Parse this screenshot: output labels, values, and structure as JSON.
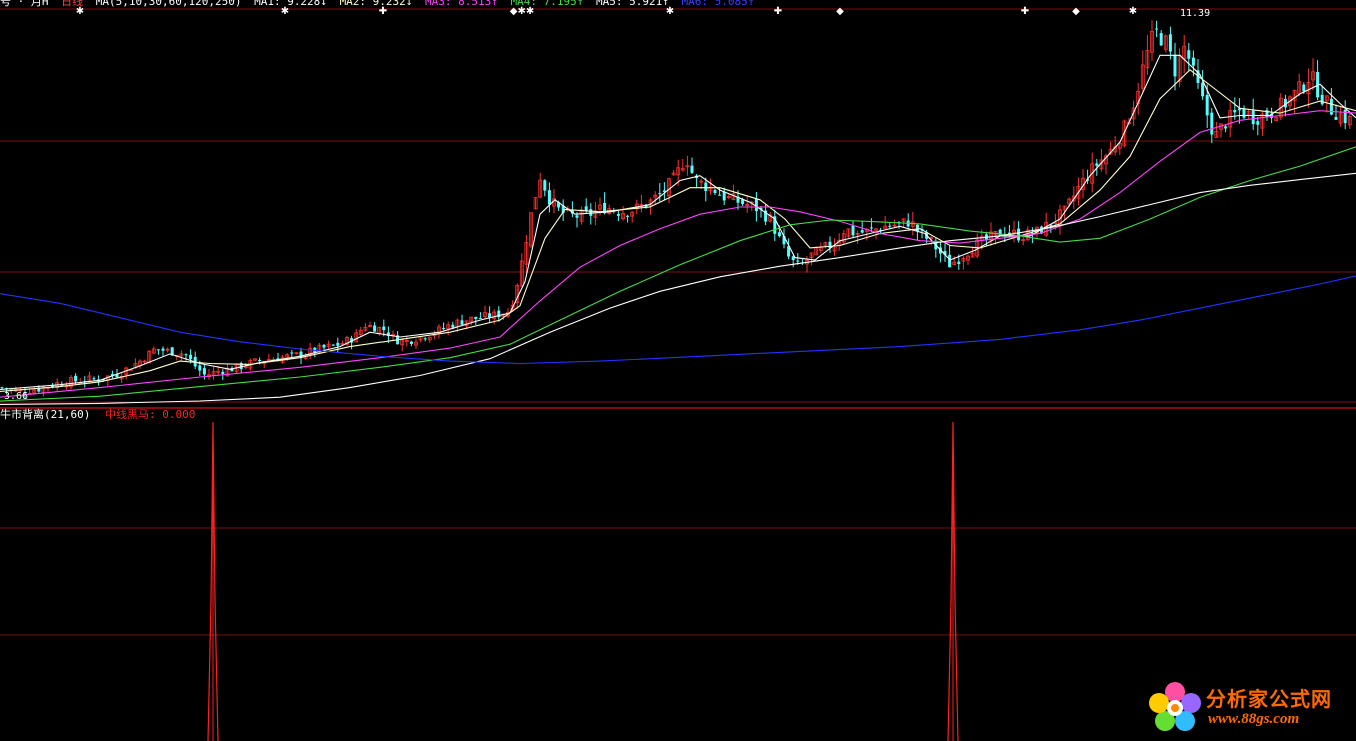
{
  "colors": {
    "bg": "#000000",
    "grid": "#7a1010",
    "up": "#ff3030",
    "down": "#54ffff",
    "ma1": "#ffffff",
    "ma2": "#ffffcc",
    "ma3": "#ff44ff",
    "ma4": "#44dd44",
    "ma5": "#ffffff",
    "ma6": "#2233ff",
    "signal": "#ff2020",
    "header_text": "#ffffff"
  },
  "header": {
    "title": "号 · 月H",
    "period": "日线",
    "ma_params": "MA(5,10,30,60,120,250)",
    "ma1": "MA1: 9.228↓",
    "ma2": "MA2: 9.232↓",
    "ma3": "MA3: 8.513↑",
    "ma4": "MA4: 7.195↑",
    "ma5": "MA5: 5.921↑",
    "ma6": "MA6: 5.085↑"
  },
  "sub_header": {
    "name": "牛市背离(21,60)",
    "indicator": "中线黑马: 0.000"
  },
  "watermark": {
    "text": "分析家公式网",
    "url": "www.88gs.com"
  },
  "chart_data": {
    "type": "candlestick",
    "price_range": [
      3.5,
      11.6
    ],
    "low_label": "3.66",
    "high_label": "11.39",
    "grid": true,
    "close_curve": [
      [
        0,
        3.8
      ],
      [
        20,
        3.72
      ],
      [
        40,
        3.78
      ],
      [
        60,
        3.9
      ],
      [
        80,
        3.95
      ],
      [
        100,
        3.98
      ],
      [
        120,
        4.1
      ],
      [
        140,
        4.35
      ],
      [
        155,
        4.6
      ],
      [
        170,
        4.55
      ],
      [
        185,
        4.5
      ],
      [
        195,
        4.25
      ],
      [
        205,
        4.05
      ],
      [
        220,
        4.15
      ],
      [
        235,
        4.2
      ],
      [
        250,
        4.3
      ],
      [
        265,
        4.38
      ],
      [
        280,
        4.42
      ],
      [
        300,
        4.48
      ],
      [
        320,
        4.6
      ],
      [
        340,
        4.7
      ],
      [
        355,
        4.85
      ],
      [
        365,
        5.1
      ],
      [
        375,
        5.05
      ],
      [
        385,
        5.0
      ],
      [
        395,
        4.8
      ],
      [
        405,
        4.75
      ],
      [
        420,
        4.85
      ],
      [
        435,
        4.95
      ],
      [
        450,
        5.1
      ],
      [
        465,
        5.2
      ],
      [
        480,
        5.25
      ],
      [
        495,
        5.3
      ],
      [
        510,
        5.4
      ],
      [
        520,
        6.2
      ],
      [
        530,
        7.3
      ],
      [
        540,
        8.2
      ],
      [
        550,
        7.7
      ],
      [
        560,
        7.45
      ],
      [
        575,
        7.35
      ],
      [
        590,
        7.4
      ],
      [
        605,
        7.55
      ],
      [
        620,
        7.45
      ],
      [
        635,
        7.5
      ],
      [
        650,
        7.65
      ],
      [
        665,
        7.9
      ],
      [
        675,
        8.15
      ],
      [
        686,
        8.6
      ],
      [
        695,
        8.1
      ],
      [
        705,
        8.0
      ],
      [
        715,
        7.9
      ],
      [
        725,
        7.75
      ],
      [
        740,
        7.65
      ],
      [
        755,
        7.55
      ],
      [
        770,
        7.3
      ],
      [
        780,
        6.85
      ],
      [
        790,
        6.45
      ],
      [
        800,
        6.3
      ],
      [
        812,
        6.55
      ],
      [
        825,
        6.7
      ],
      [
        835,
        6.8
      ],
      [
        845,
        7.1
      ],
      [
        855,
        7.0
      ],
      [
        870,
        7.05
      ],
      [
        885,
        7.15
      ],
      [
        900,
        7.2
      ],
      [
        910,
        7.25
      ],
      [
        920,
        7.0
      ],
      [
        930,
        6.85
      ],
      [
        940,
        6.6
      ],
      [
        950,
        6.35
      ],
      [
        960,
        6.5
      ],
      [
        975,
        6.75
      ],
      [
        990,
        6.9
      ],
      [
        1005,
        7.05
      ],
      [
        1020,
        6.95
      ],
      [
        1035,
        7.0
      ],
      [
        1050,
        7.2
      ],
      [
        1065,
        7.45
      ],
      [
        1080,
        8.0
      ],
      [
        1095,
        8.4
      ],
      [
        1110,
        8.7
      ],
      [
        1125,
        9.2
      ],
      [
        1135,
        9.8
      ],
      [
        1145,
        10.6
      ],
      [
        1155,
        11.2
      ],
      [
        1165,
        11.0
      ],
      [
        1175,
        10.4
      ],
      [
        1185,
        10.9
      ],
      [
        1195,
        10.2
      ],
      [
        1205,
        9.6
      ],
      [
        1215,
        9.0
      ],
      [
        1225,
        9.3
      ],
      [
        1240,
        9.55
      ],
      [
        1255,
        9.4
      ],
      [
        1270,
        9.5
      ],
      [
        1285,
        9.7
      ],
      [
        1300,
        10.0
      ],
      [
        1310,
        10.3
      ],
      [
        1320,
        9.9
      ],
      [
        1330,
        9.6
      ],
      [
        1345,
        9.4
      ],
      [
        1356,
        9.3
      ]
    ],
    "series": [
      {
        "name": "MA1",
        "color": "#ffffff",
        "points": [
          [
            0,
            3.76
          ],
          [
            60,
            3.86
          ],
          [
            100,
            3.95
          ],
          [
            140,
            4.25
          ],
          [
            170,
            4.5
          ],
          [
            200,
            4.3
          ],
          [
            230,
            4.18
          ],
          [
            260,
            4.32
          ],
          [
            300,
            4.45
          ],
          [
            340,
            4.65
          ],
          [
            370,
            4.95
          ],
          [
            400,
            4.85
          ],
          [
            440,
            4.95
          ],
          [
            480,
            5.2
          ],
          [
            510,
            5.35
          ],
          [
            525,
            6.0
          ],
          [
            540,
            7.4
          ],
          [
            555,
            7.7
          ],
          [
            575,
            7.4
          ],
          [
            610,
            7.45
          ],
          [
            650,
            7.6
          ],
          [
            680,
            8.1
          ],
          [
            700,
            8.2
          ],
          [
            720,
            7.9
          ],
          [
            750,
            7.65
          ],
          [
            775,
            7.3
          ],
          [
            795,
            6.5
          ],
          [
            815,
            6.45
          ],
          [
            840,
            6.85
          ],
          [
            870,
            7.0
          ],
          [
            900,
            7.15
          ],
          [
            925,
            7.0
          ],
          [
            950,
            6.45
          ],
          [
            975,
            6.65
          ],
          [
            1000,
            6.95
          ],
          [
            1030,
            6.95
          ],
          [
            1060,
            7.3
          ],
          [
            1090,
            8.2
          ],
          [
            1120,
            8.9
          ],
          [
            1140,
            9.8
          ],
          [
            1160,
            10.7
          ],
          [
            1180,
            10.7
          ],
          [
            1200,
            10.3
          ],
          [
            1220,
            9.4
          ],
          [
            1240,
            9.45
          ],
          [
            1270,
            9.45
          ],
          [
            1300,
            9.9
          ],
          [
            1320,
            10.1
          ],
          [
            1340,
            9.7
          ],
          [
            1356,
            9.4
          ]
        ]
      },
      {
        "name": "MA2",
        "color": "#ffffcc",
        "points": [
          [
            0,
            3.72
          ],
          [
            60,
            3.82
          ],
          [
            100,
            3.92
          ],
          [
            150,
            4.15
          ],
          [
            180,
            4.35
          ],
          [
            210,
            4.3
          ],
          [
            250,
            4.28
          ],
          [
            300,
            4.42
          ],
          [
            350,
            4.65
          ],
          [
            400,
            4.8
          ],
          [
            450,
            4.95
          ],
          [
            500,
            5.2
          ],
          [
            520,
            5.5
          ],
          [
            545,
            6.9
          ],
          [
            565,
            7.5
          ],
          [
            600,
            7.45
          ],
          [
            650,
            7.55
          ],
          [
            690,
            7.95
          ],
          [
            720,
            7.95
          ],
          [
            760,
            7.7
          ],
          [
            785,
            7.3
          ],
          [
            810,
            6.7
          ],
          [
            840,
            6.75
          ],
          [
            880,
            7.0
          ],
          [
            920,
            7.1
          ],
          [
            950,
            6.75
          ],
          [
            980,
            6.7
          ],
          [
            1020,
            6.95
          ],
          [
            1060,
            7.2
          ],
          [
            1100,
            7.9
          ],
          [
            1130,
            8.6
          ],
          [
            1160,
            9.8
          ],
          [
            1190,
            10.4
          ],
          [
            1215,
            10.0
          ],
          [
            1240,
            9.6
          ],
          [
            1280,
            9.5
          ],
          [
            1320,
            9.75
          ],
          [
            1356,
            9.55
          ]
        ]
      },
      {
        "name": "MA3",
        "color": "#ff44ff",
        "points": [
          [
            0,
            3.6
          ],
          [
            100,
            3.8
          ],
          [
            200,
            4.02
          ],
          [
            300,
            4.22
          ],
          [
            380,
            4.42
          ],
          [
            450,
            4.62
          ],
          [
            500,
            4.85
          ],
          [
            540,
            5.6
          ],
          [
            580,
            6.3
          ],
          [
            620,
            6.75
          ],
          [
            660,
            7.1
          ],
          [
            700,
            7.4
          ],
          [
            740,
            7.55
          ],
          [
            770,
            7.55
          ],
          [
            800,
            7.45
          ],
          [
            840,
            7.25
          ],
          [
            880,
            7.0
          ],
          [
            920,
            6.85
          ],
          [
            960,
            6.8
          ],
          [
            1000,
            6.9
          ],
          [
            1040,
            7.0
          ],
          [
            1080,
            7.3
          ],
          [
            1120,
            7.85
          ],
          [
            1160,
            8.5
          ],
          [
            1200,
            9.1
          ],
          [
            1240,
            9.35
          ],
          [
            1280,
            9.45
          ],
          [
            1320,
            9.55
          ],
          [
            1356,
            9.5
          ]
        ]
      },
      {
        "name": "MA4",
        "color": "#44dd44",
        "points": [
          [
            0,
            3.52
          ],
          [
            100,
            3.62
          ],
          [
            200,
            3.82
          ],
          [
            300,
            4.02
          ],
          [
            380,
            4.22
          ],
          [
            450,
            4.42
          ],
          [
            510,
            4.7
          ],
          [
            560,
            5.2
          ],
          [
            620,
            5.8
          ],
          [
            680,
            6.35
          ],
          [
            740,
            6.85
          ],
          [
            790,
            7.18
          ],
          [
            830,
            7.28
          ],
          [
            870,
            7.25
          ],
          [
            920,
            7.2
          ],
          [
            970,
            7.05
          ],
          [
            1020,
            6.95
          ],
          [
            1060,
            6.82
          ],
          [
            1100,
            6.9
          ],
          [
            1150,
            7.3
          ],
          [
            1200,
            7.75
          ],
          [
            1250,
            8.1
          ],
          [
            1300,
            8.4
          ],
          [
            1356,
            8.8
          ]
        ]
      },
      {
        "name": "MA5",
        "color": "#ffffff",
        "points": [
          [
            0,
            3.45
          ],
          [
            100,
            3.47
          ],
          [
            200,
            3.52
          ],
          [
            280,
            3.6
          ],
          [
            350,
            3.8
          ],
          [
            420,
            4.05
          ],
          [
            490,
            4.4
          ],
          [
            550,
            4.95
          ],
          [
            610,
            5.45
          ],
          [
            660,
            5.8
          ],
          [
            720,
            6.1
          ],
          [
            780,
            6.32
          ],
          [
            840,
            6.5
          ],
          [
            900,
            6.7
          ],
          [
            950,
            6.85
          ],
          [
            1000,
            6.95
          ],
          [
            1050,
            7.12
          ],
          [
            1100,
            7.35
          ],
          [
            1150,
            7.6
          ],
          [
            1200,
            7.85
          ],
          [
            1250,
            8.0
          ],
          [
            1300,
            8.12
          ],
          [
            1356,
            8.25
          ]
        ]
      },
      {
        "name": "MA6",
        "color": "#2233ff",
        "points": [
          [
            0,
            5.75
          ],
          [
            60,
            5.55
          ],
          [
            120,
            5.25
          ],
          [
            180,
            4.95
          ],
          [
            240,
            4.75
          ],
          [
            300,
            4.6
          ],
          [
            380,
            4.45
          ],
          [
            450,
            4.35
          ],
          [
            520,
            4.3
          ],
          [
            600,
            4.35
          ],
          [
            700,
            4.45
          ],
          [
            800,
            4.55
          ],
          [
            900,
            4.65
          ],
          [
            1000,
            4.8
          ],
          [
            1080,
            5.0
          ],
          [
            1140,
            5.2
          ],
          [
            1200,
            5.45
          ],
          [
            1260,
            5.7
          ],
          [
            1320,
            5.95
          ],
          [
            1356,
            6.12
          ]
        ]
      }
    ],
    "signal_spikes": [
      213,
      953
    ],
    "markers": [
      {
        "x": 80,
        "glyph": "✱"
      },
      {
        "x": 285,
        "glyph": "✱"
      },
      {
        "x": 383,
        "glyph": "✚"
      },
      {
        "x": 522,
        "glyph": "◆✱✱"
      },
      {
        "x": 670,
        "glyph": "✱"
      },
      {
        "x": 778,
        "glyph": "✚"
      },
      {
        "x": 840,
        "glyph": "◆"
      },
      {
        "x": 1025,
        "glyph": "✚"
      },
      {
        "x": 1076,
        "glyph": "◆"
      },
      {
        "x": 1133,
        "glyph": "✱"
      }
    ]
  }
}
